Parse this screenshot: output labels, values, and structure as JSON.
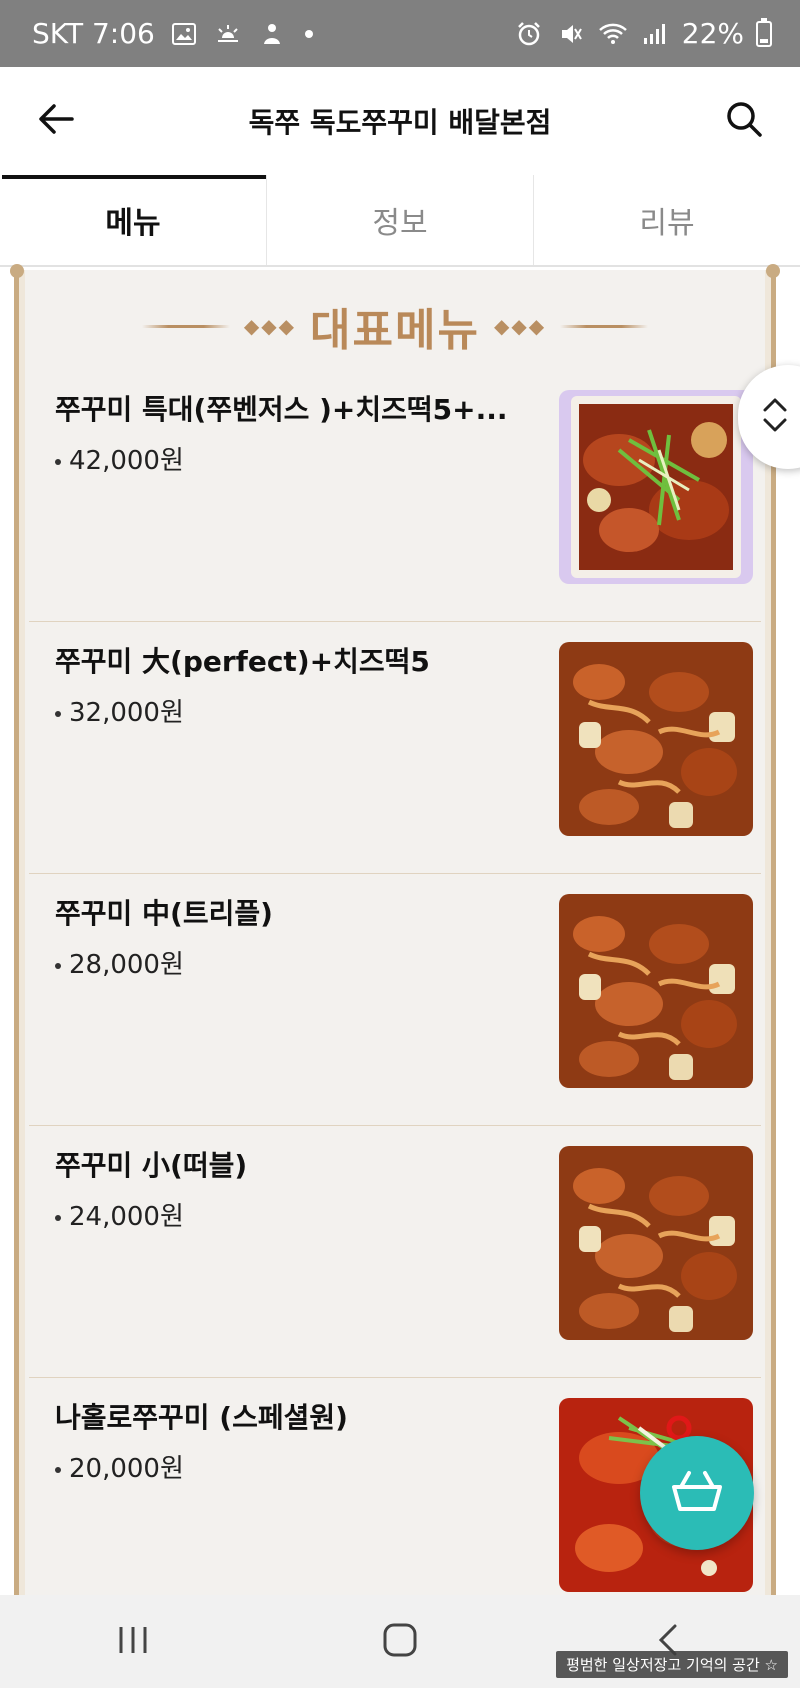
{
  "status_bar": {
    "carrier_time": "SKT 7:06",
    "battery": "22%",
    "battery_level": 0.22,
    "left_icons": [
      "gallery-icon",
      "weather-icon",
      "bixby-icon",
      "dot-icon"
    ],
    "right_icons": [
      "alarm-icon",
      "mute-icon",
      "wifi-icon",
      "signal-icon",
      "battery-icon"
    ]
  },
  "header": {
    "title": "독쭈 독도쭈꾸미 배달본점",
    "back_icon": "back-arrow-icon",
    "search_icon": "search-icon"
  },
  "tabs": [
    {
      "label": "메뉴",
      "active": true
    },
    {
      "label": "정보",
      "active": false
    },
    {
      "label": "리뷰",
      "active": false
    }
  ],
  "board": {
    "title": "대표메뉴",
    "accent_color": "#b98959"
  },
  "menu_items": [
    {
      "name": "쭈꾸미 특대(쭈벤저스 )+치즈떡5+...",
      "price": "42,000원",
      "image": "jjukkumi-tray-photo"
    },
    {
      "name": "쭈꾸미 大(perfect)+치즈떡5",
      "price": "32,000원",
      "image": "jjukkumi-stirfry-photo"
    },
    {
      "name": "쭈꾸미 中(트리플)",
      "price": "28,000원",
      "image": "jjukkumi-stirfry-photo"
    },
    {
      "name": "쭈꾸미  小(떠블)",
      "price": "24,000원",
      "image": "jjukkumi-stirfry-photo"
    },
    {
      "name": "나홀로쭈꾸미 (스페셜원)",
      "price": "20,000원",
      "image": "jjukkumi-noodle-photo"
    }
  ],
  "floating": {
    "scroll_icon": "scroll-updown-icon",
    "cart_icon": "basket-icon",
    "cart_color": "#2bbcb6"
  },
  "nav": {
    "recents_icon": "recents-icon",
    "home_icon": "home-icon",
    "back_icon": "nav-back-icon"
  },
  "watermark": "평범한 일상저장고 기억의 공간 ☆"
}
